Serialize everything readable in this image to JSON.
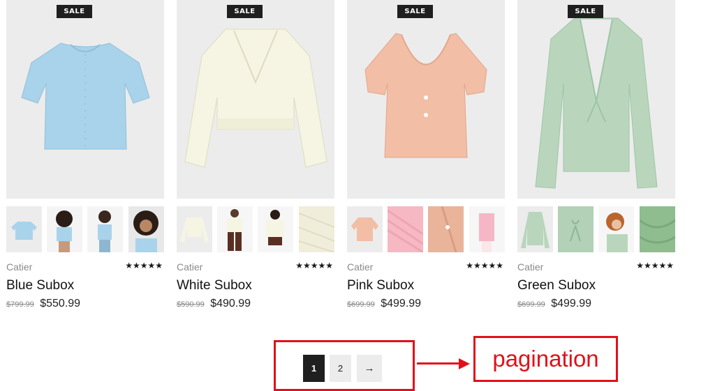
{
  "products": [
    {
      "badge": "SALE",
      "brand": "Catier",
      "name": "Blue Subox",
      "old_price": "$799.99",
      "price": "$550.99",
      "rating": "★★★★★",
      "color": "#a9d3ea",
      "image": "blue-cardigan-tee-image",
      "thumbs": [
        "blue-top-flat-thumb",
        "model-curly-hair-back-thumb",
        "model-blue-top-thumb",
        "model-blue-top-portrait-thumb"
      ]
    },
    {
      "badge": "SALE",
      "brand": "Catier",
      "name": "White Subox",
      "old_price": "$590.99",
      "price": "$490.99",
      "rating": "★★★★★",
      "color": "#f6f5e3",
      "image": "white-sweater-image",
      "thumbs": [
        "white-sweater-flat-thumb",
        "model-white-sweater-thumb",
        "model-white-sweater-crop-thumb",
        "white-knit-detail-thumb"
      ]
    },
    {
      "badge": "SALE",
      "brand": "Catier",
      "name": "Pink Subox",
      "old_price": "$699.99",
      "price": "$499.99",
      "rating": "★★★★★",
      "color": "#f2bea6",
      "image": "peach-top-image",
      "thumbs": [
        "peach-top-flat-thumb",
        "pink-rib-detail-thumb",
        "peach-button-detail-thumb",
        "model-pink-cardigan-thumb"
      ]
    },
    {
      "badge": "SALE",
      "brand": "Catier",
      "name": "Green Subox",
      "old_price": "$699.99",
      "price": "$499.99",
      "rating": "★★★★★",
      "color": "#b9d6bd",
      "image": "green-cardigan-image",
      "thumbs": [
        "green-cardigan-flat-thumb",
        "green-tie-detail-thumb",
        "model-green-cardigan-thumb",
        "green-fabric-detail-thumb"
      ]
    }
  ],
  "pagination": {
    "page1": "1",
    "page2": "2",
    "next": "→"
  },
  "annotation": {
    "label": "pagination",
    "color": "#e1111a"
  }
}
